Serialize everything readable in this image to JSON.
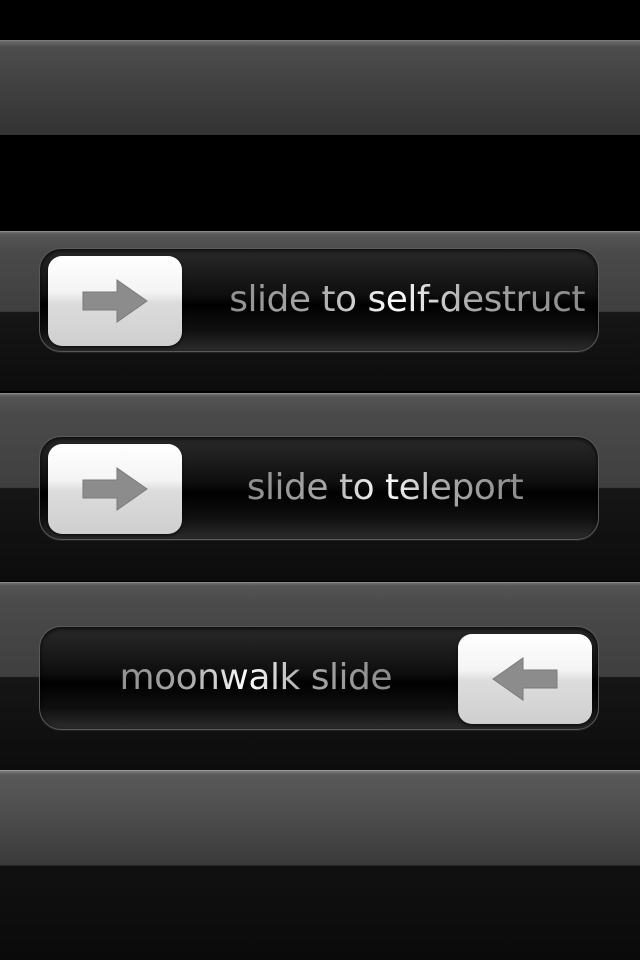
{
  "sliders": [
    {
      "label": "slide to self-destruct",
      "direction": "right",
      "icon": "arrow-right-icon"
    },
    {
      "label": "slide to teleport",
      "direction": "right",
      "icon": "arrow-right-icon"
    },
    {
      "label": "moonwalk slide",
      "direction": "left",
      "icon": "arrow-left-icon"
    }
  ],
  "colors": {
    "background": "#000000",
    "band": "#4a4a4a",
    "track": "#000000",
    "knob": "#f2f2f2",
    "arrow": "#8c8c8c",
    "label_base": "#a8a8a8",
    "label_highlight": "#ffffff"
  }
}
